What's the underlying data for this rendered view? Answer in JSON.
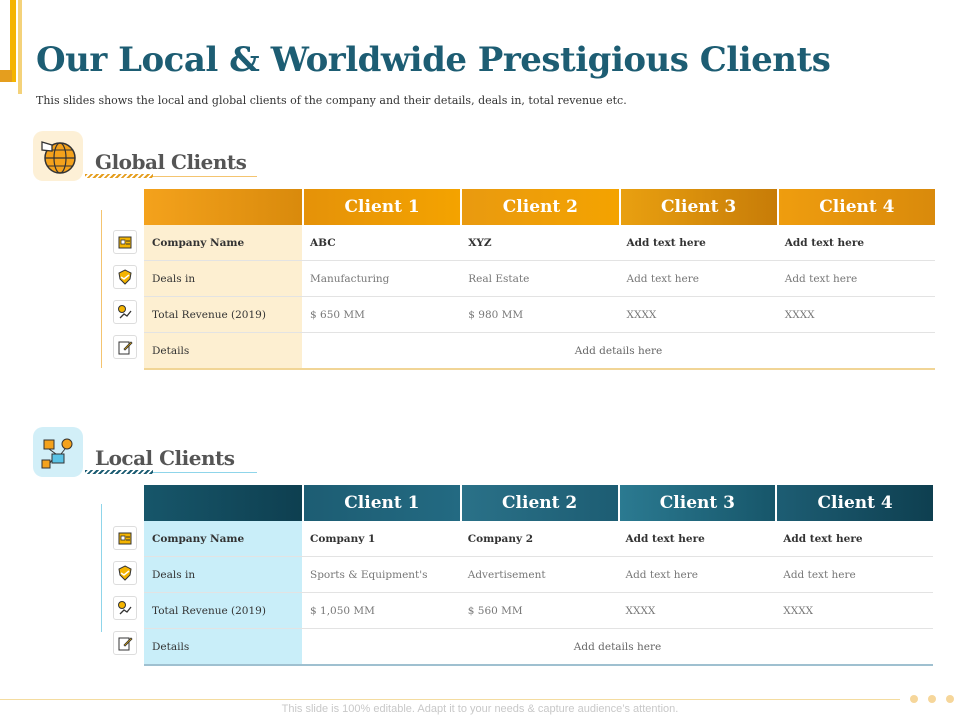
{
  "title": "Our Local & Worldwide Prestigious Clients",
  "subtitle": "This slides shows the local and global clients of the company and their details, deals in, total revenue etc.",
  "colors": {
    "accent_orange": "#e59e1e",
    "accent_teal": "#1d5d73",
    "global_label_bg": "#fdefd1",
    "local_label_bg": "#c9eef9"
  },
  "global": {
    "title": "Global Clients",
    "icon": "globe-megaphone-icon",
    "headers": [
      "Client 1",
      "Client 2",
      "Client 3",
      "Client 4"
    ],
    "row_labels": [
      "Company Name",
      "Deals in",
      "Total Revenue (2019)",
      "Details"
    ],
    "row_icons": [
      "id-card-icon",
      "handshake-shield-icon",
      "revenue-chart-icon",
      "document-pen-icon"
    ],
    "company": [
      "ABC",
      "XYZ",
      "Add text here",
      "Add text here"
    ],
    "deals": [
      "Manufacturing",
      "Real Estate",
      "Add text here",
      "Add text here"
    ],
    "revenue": [
      "$ 650 MM",
      "$ 980 MM",
      "XXXX",
      "XXXX"
    ],
    "details": "Add details here"
  },
  "local": {
    "title": "Local Clients",
    "icon": "network-people-icon",
    "headers": [
      "Client 1",
      "Client 2",
      "Client 3",
      "Client 4"
    ],
    "row_labels": [
      "Company Name",
      "Deals in",
      "Total Revenue (2019)",
      "Details"
    ],
    "row_icons": [
      "id-card-icon",
      "handshake-shield-icon",
      "revenue-chart-icon",
      "document-pen-icon"
    ],
    "company": [
      "Company 1",
      "Company 2",
      "Add text here",
      "Add text here"
    ],
    "deals": [
      "Sports & Equipment's",
      "Advertisement",
      "Add text here",
      "Add text here"
    ],
    "revenue": [
      "$ 1,050 MM",
      "$ 560 MM",
      "XXXX",
      "XXXX"
    ],
    "details": "Add details here"
  },
  "footer": "This slide is 100% editable. Adapt it to your needs & capture audience’s attention."
}
